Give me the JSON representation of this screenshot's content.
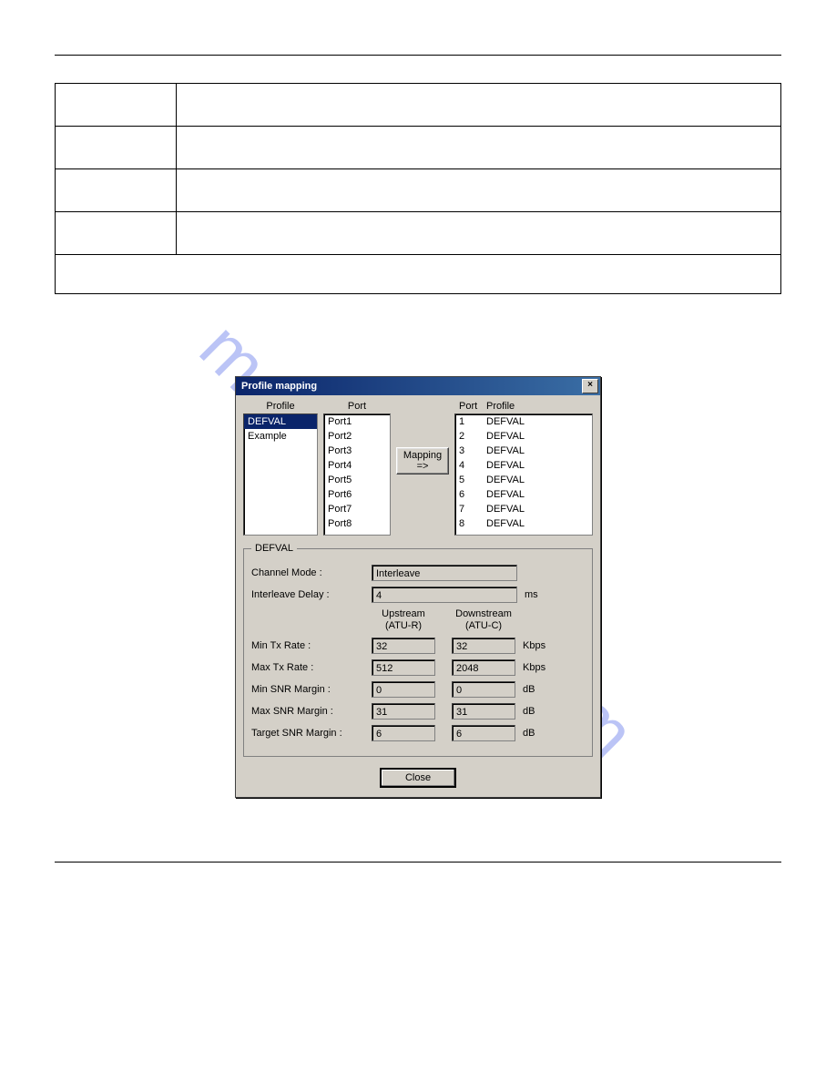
{
  "watermark": "manualshive.com",
  "dialog": {
    "title": "Profile mapping",
    "close_x": "×",
    "headers": {
      "profile": "Profile",
      "port": "Port",
      "map_port": "Port",
      "map_profile": "Profile"
    },
    "profiles": [
      "DEFVAL",
      "Example"
    ],
    "ports": [
      "Port1",
      "Port2",
      "Port3",
      "Port4",
      "Port5",
      "Port6",
      "Port7",
      "Port8"
    ],
    "mapping_button": "Mapping =>",
    "map": [
      {
        "port": "1",
        "profile": "DEFVAL"
      },
      {
        "port": "2",
        "profile": "DEFVAL"
      },
      {
        "port": "3",
        "profile": "DEFVAL"
      },
      {
        "port": "4",
        "profile": "DEFVAL"
      },
      {
        "port": "5",
        "profile": "DEFVAL"
      },
      {
        "port": "6",
        "profile": "DEFVAL"
      },
      {
        "port": "7",
        "profile": "DEFVAL"
      },
      {
        "port": "8",
        "profile": "DEFVAL"
      }
    ],
    "group": {
      "legend": "DEFVAL",
      "channel_mode_label": "Channel Mode :",
      "channel_mode_value": "Interleave",
      "interleave_label": "Interleave Delay :",
      "interleave_value": "4",
      "interleave_unit": "ms",
      "upstream_label": "Upstream\n(ATU-R)",
      "downstream_label": "Downstream\n(ATU-C)",
      "rows": [
        {
          "label": "Min Tx Rate :",
          "up": "32",
          "down": "32",
          "unit": "Kbps"
        },
        {
          "label": "Max Tx Rate :",
          "up": "512",
          "down": "2048",
          "unit": "Kbps"
        },
        {
          "label": "Min  SNR Margin :",
          "up": "0",
          "down": "0",
          "unit": "dB"
        },
        {
          "label": "Max SNR Margin :",
          "up": "31",
          "down": "31",
          "unit": "dB"
        },
        {
          "label": "Target SNR Margin :",
          "up": "6",
          "down": "6",
          "unit": "dB"
        }
      ]
    },
    "close_button": "Close"
  }
}
